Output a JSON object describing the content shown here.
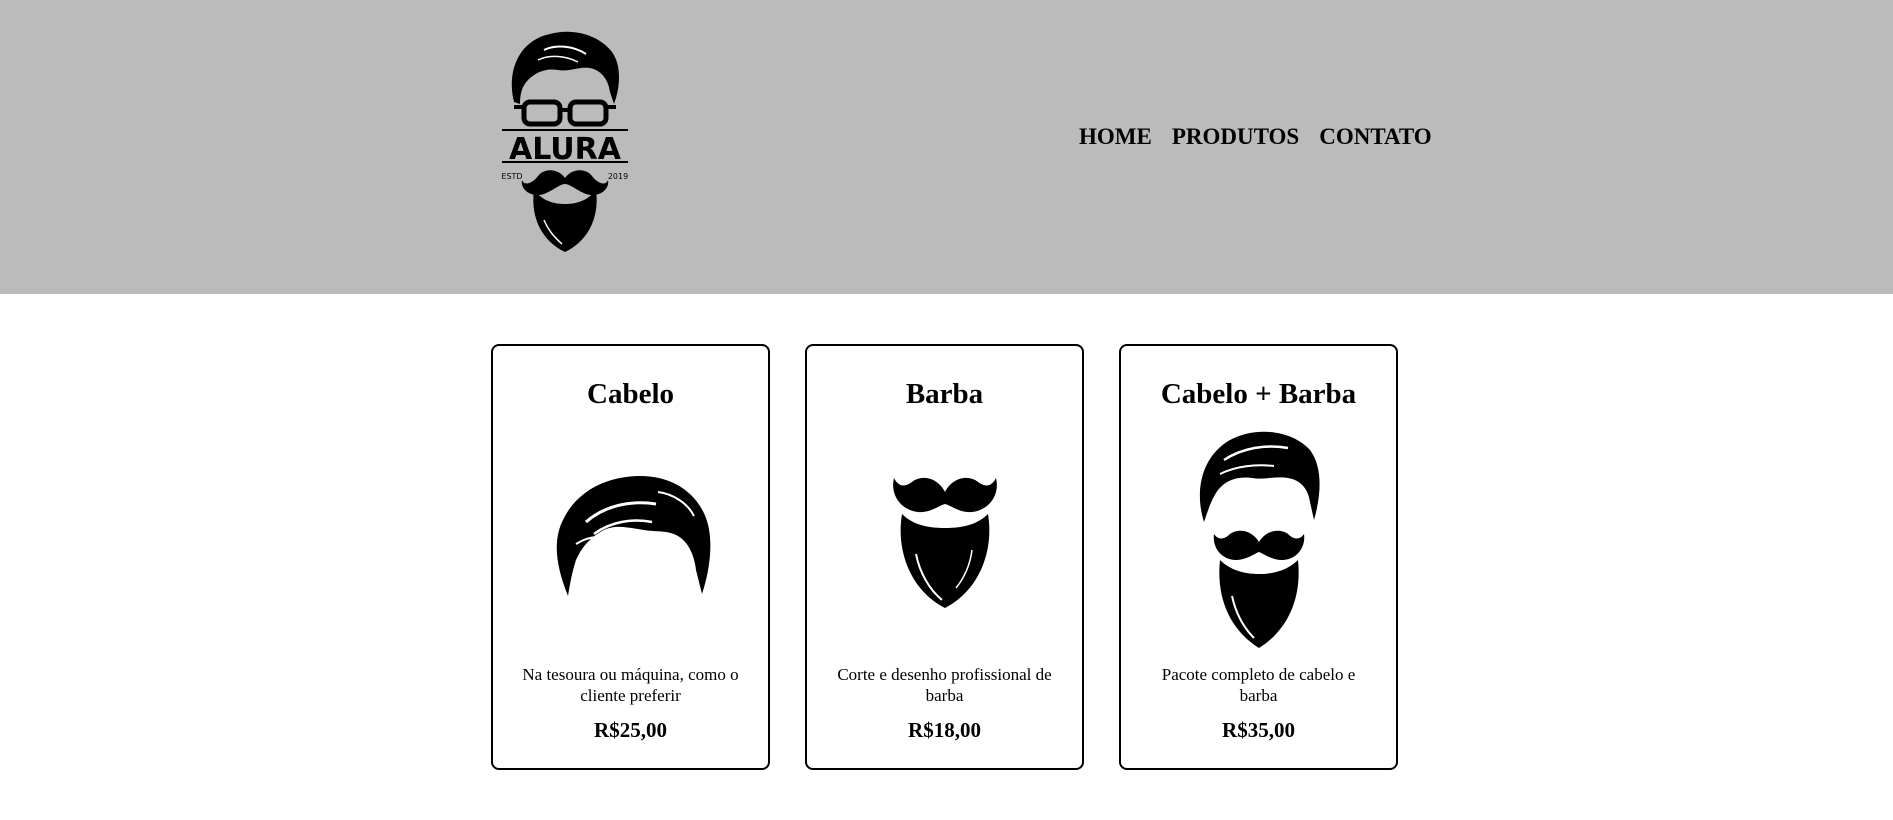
{
  "header": {
    "logo": {
      "brand": "ALURA",
      "established_left": "ESTD",
      "established_right": "2019"
    },
    "nav": [
      {
        "label": "HOME"
      },
      {
        "label": "PRODUTOS"
      },
      {
        "label": "CONTATO"
      }
    ]
  },
  "products": [
    {
      "title": "Cabelo",
      "icon": "hair-icon",
      "description": "Na tesoura ou máquina, como o cliente preferir",
      "price": "R$25,00"
    },
    {
      "title": "Barba",
      "icon": "beard-icon",
      "description": "Corte e desenho profissional de barba",
      "price": "R$18,00"
    },
    {
      "title": "Cabelo + Barba",
      "icon": "hair-and-beard-icon",
      "description": "Pacote completo de cabelo e barba",
      "price": "R$35,00"
    }
  ],
  "colors": {
    "header_background": "#bbbbbb",
    "page_background": "#ffffff",
    "text": "#000000"
  }
}
